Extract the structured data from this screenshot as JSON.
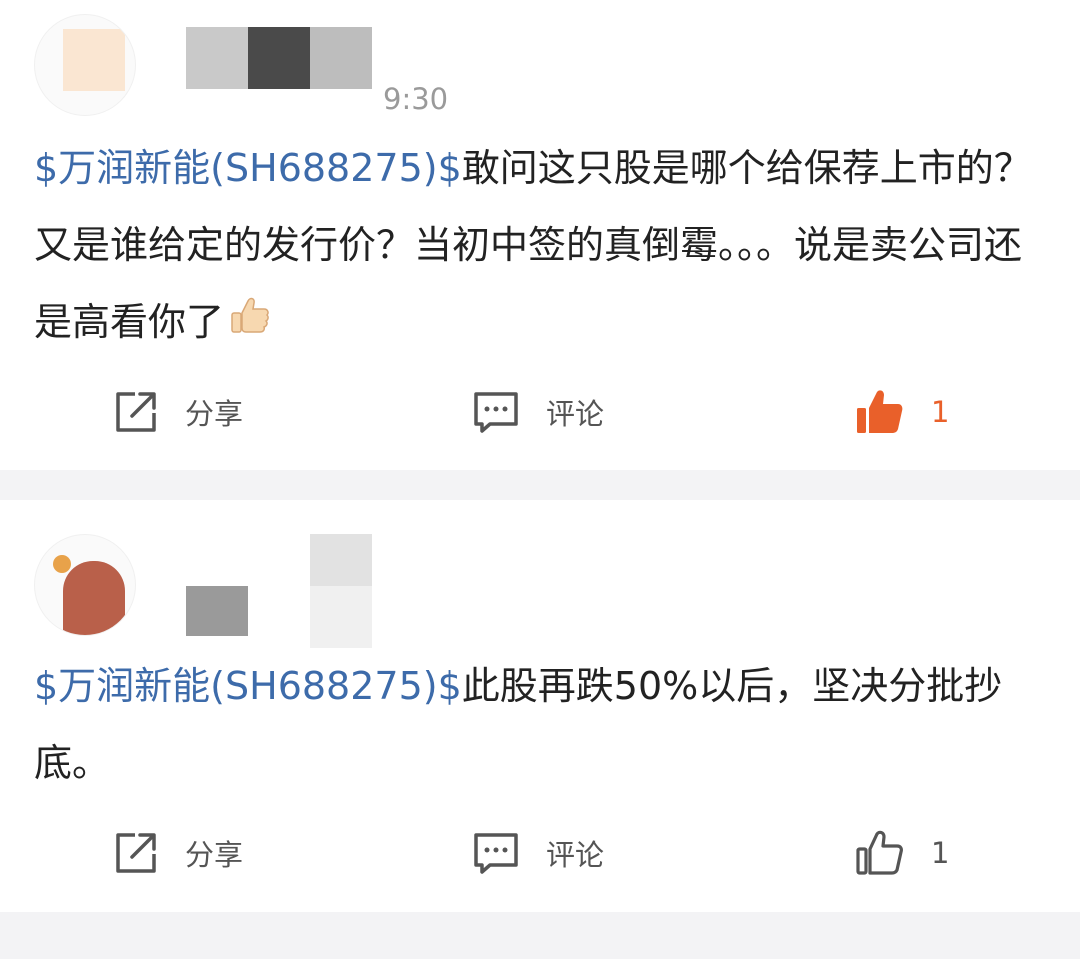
{
  "colors": {
    "stock_link": "#3d6baa",
    "text": "#222222",
    "muted": "#555555",
    "timestamp": "#9a9a9a",
    "like_active": "#e9602a",
    "separator": "#f3f3f5"
  },
  "posts": [
    {
      "timestamp_fragment": "9:30",
      "stock_tag": "$万润新能(SH688275)$",
      "text": "敢问这只股是哪个给保荐上市的？又是谁给定的发行价？当初中签的真倒霉。。。说是卖公司还是高看你了",
      "inline_emoji": "thumbs-up-emoji",
      "actions": {
        "share_label": "分享",
        "comment_label": "评论",
        "like_count": "1",
        "liked": true
      }
    },
    {
      "stock_tag": "$万润新能(SH688275)$",
      "text": "此股再跌50%以后，坚决分批抄底。",
      "actions": {
        "share_label": "分享",
        "comment_label": "评论",
        "like_count": "1",
        "liked": false
      }
    }
  ],
  "icons": {
    "share": "share-icon",
    "comment": "comment-icon",
    "like": "thumbs-up-icon"
  }
}
